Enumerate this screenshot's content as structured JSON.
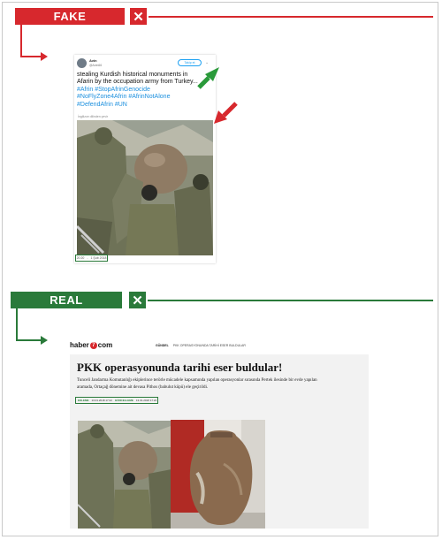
{
  "fake": {
    "label": "FAKE",
    "x_mark": "✕",
    "color": "#d7282d",
    "tweet": {
      "name": "Avin",
      "handle": "@Avin66",
      "follow": "Takip et",
      "text_line1": "stealing Kurdish historical monuments in",
      "text_line2": "Afarin by the occupation army from Turkey...",
      "tags_line1": [
        "#Afrin",
        "#StopAfrinGenocide"
      ],
      "tags_line2": [
        "#NoFlyZone4Afrin",
        "#AfrinNotAlone"
      ],
      "tags_line3": [
        "#DefendAfrin",
        "#UN"
      ],
      "translate": "İngilizce dilinden çevir",
      "time": "20:20",
      "date": "1 Şub 2018"
    }
  },
  "real": {
    "label": "REAL",
    "x_mark": "✕",
    "color": "#2a7a3a",
    "article": {
      "logo_before": "haber",
      "logo_seven": "7",
      "logo_after": "com",
      "section": "GÜNDEL",
      "breadcrumb": "PKK OPERASYONUNDA TARİHİ ESER BULDULAR",
      "title": "PKK operasyonunda tarihi eser buldular!",
      "lead_line1": "Tunceli Jandarma Komutanlığı ekiplerince terörle mücadele kapsamında yapılan operasyonlar sırasında Pertek ilesinde bir evde yapılan",
      "lead_line2": "aramada, Ortaçağ dönemine ait devasa Pithos (babulut küpü) ele geçirildi.",
      "date_label1": "EKLEME",
      "date1": "13.01.2018 17:22",
      "date_label2": "GÜNCELLEME",
      "date2": "13.01.2018 17:22"
    }
  }
}
